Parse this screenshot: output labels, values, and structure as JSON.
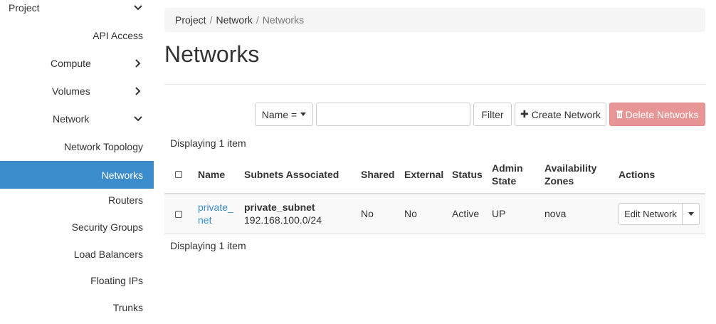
{
  "sidebar": {
    "project": "Project",
    "api_access": "API Access",
    "compute": "Compute",
    "volumes": "Volumes",
    "network": "Network",
    "network_topology": "Network Topology",
    "networks": "Networks",
    "routers": "Routers",
    "security_groups": "Security Groups",
    "load_balancers": "Load Balancers",
    "floating_ips": "Floating IPs",
    "trunks": "Trunks"
  },
  "breadcrumb": [
    "Project",
    "Network",
    "Networks"
  ],
  "page_title": "Networks",
  "toolbar": {
    "filter_field": "Name =",
    "filter_value": "",
    "filter_button": "Filter",
    "create_button": "Create Network",
    "delete_button": "Delete Networks"
  },
  "display_count": "Displaying 1 item",
  "table": {
    "headers": {
      "name": "Name",
      "subnets": "Subnets Associated",
      "shared": "Shared",
      "external": "External",
      "status": "Status",
      "admin_state_1": "Admin",
      "admin_state_2": "State",
      "zones_1": "Availability",
      "zones_2": "Zones",
      "actions": "Actions"
    },
    "rows": [
      {
        "name_1": "private_",
        "name_2": "net",
        "subnet_name": "private_subnet",
        "subnet_cidr": "192.168.100.0/24",
        "shared": "No",
        "external": "No",
        "status": "Active",
        "admin_state": "UP",
        "zones": "nova",
        "action": "Edit Network"
      }
    ]
  },
  "colors": {
    "accent": "#3c8dcc",
    "danger": "#e89595"
  }
}
